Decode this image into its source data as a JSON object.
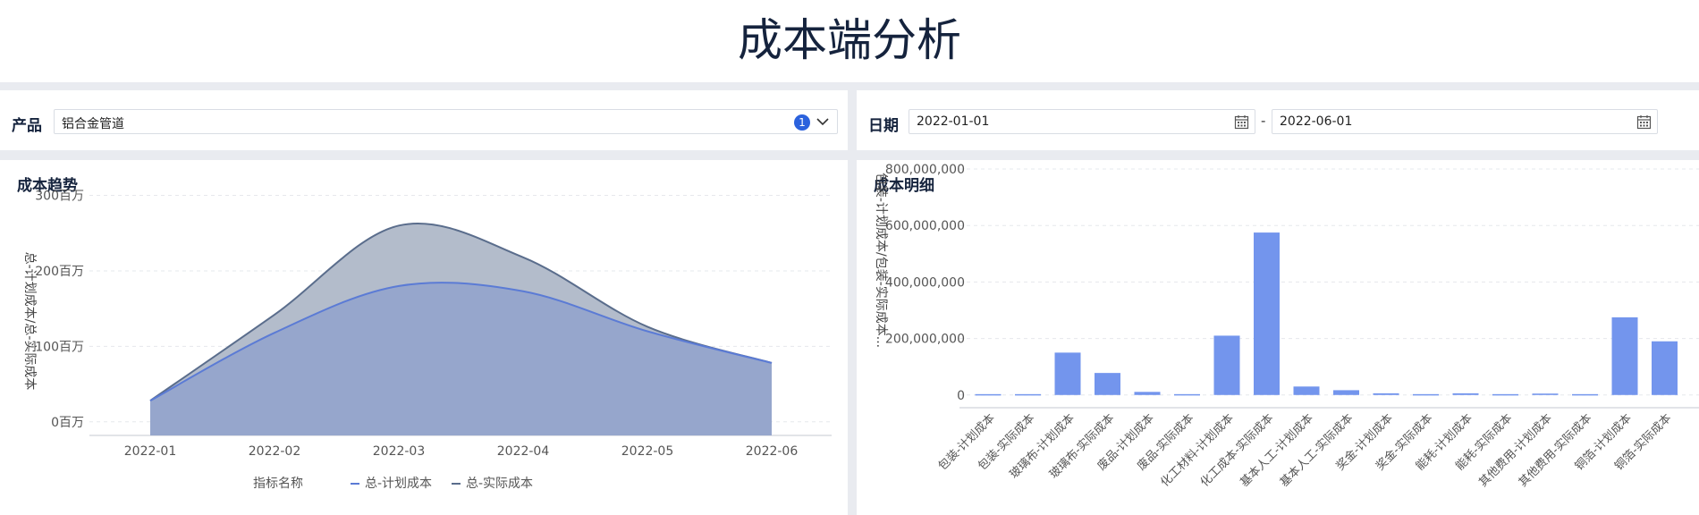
{
  "header": {
    "title": "成本端分析"
  },
  "filters": {
    "product_label": "产品",
    "product_value": "铝合金管道",
    "product_count": "1",
    "date_label": "日期",
    "date_start": "2022-01-01",
    "date_separator": "-",
    "date_end": "2022-06-01"
  },
  "trend": {
    "title": "成本趋势",
    "ylabel": "总-计划成本/总-实际成本",
    "legend_title": "指标名称",
    "chart_data": {
      "type": "area",
      "x": [
        "2022-01",
        "2022-02",
        "2022-03",
        "2022-04",
        "2022-05",
        "2022-06"
      ],
      "yticks": [
        0,
        100,
        200,
        300
      ],
      "ytick_labels": [
        "0百万",
        "100百万",
        "200百万",
        "300百万"
      ],
      "ylim": [
        -18,
        335
      ],
      "series": [
        {
          "name": "总-计划成本",
          "values": [
            28,
            118,
            180,
            173,
            120,
            78
          ],
          "color": "#5b7bd5"
        },
        {
          "name": "总-实际成本",
          "values": [
            28,
            142,
            260,
            218,
            126,
            78
          ],
          "color": "#5a6d8c"
        }
      ]
    }
  },
  "detail": {
    "title": "成本明细",
    "ylabel": "包装-计划成本/包装-实际成本...",
    "chart_data": {
      "type": "bar",
      "categories": [
        "包装-计划成本",
        "包装-实际成本",
        "玻璃布-计划成本",
        "玻璃布-实际成本",
        "废品-计划成本",
        "废品-实际成本",
        "化工材料-计划成本",
        "化工成本-实际成本",
        "基本人工-计划成本",
        "基本人工-实际成本",
        "奖金-计划成本",
        "奖金-实际成本",
        "能耗-计划成本",
        "能耗-实际成本",
        "其他费用-计划成本",
        "其他费用-实际成本",
        "铜箔-计划成本",
        "铜箔-实际成本"
      ],
      "values": [
        3000000,
        3000000,
        150000000,
        78000000,
        11000000,
        3000000,
        210000000,
        575000000,
        30000000,
        17000000,
        6000000,
        3000000,
        6000000,
        3000000,
        5000000,
        3000000,
        275000000,
        190000000
      ],
      "yticks": [
        0,
        200000000,
        400000000,
        600000000,
        800000000
      ],
      "ytick_labels": [
        "0",
        "200,000,000",
        "400,000,000",
        "600,000,000",
        "800,000,000"
      ],
      "ylim": [
        -45000000,
        800000000
      ],
      "color": "#7395ed"
    }
  }
}
